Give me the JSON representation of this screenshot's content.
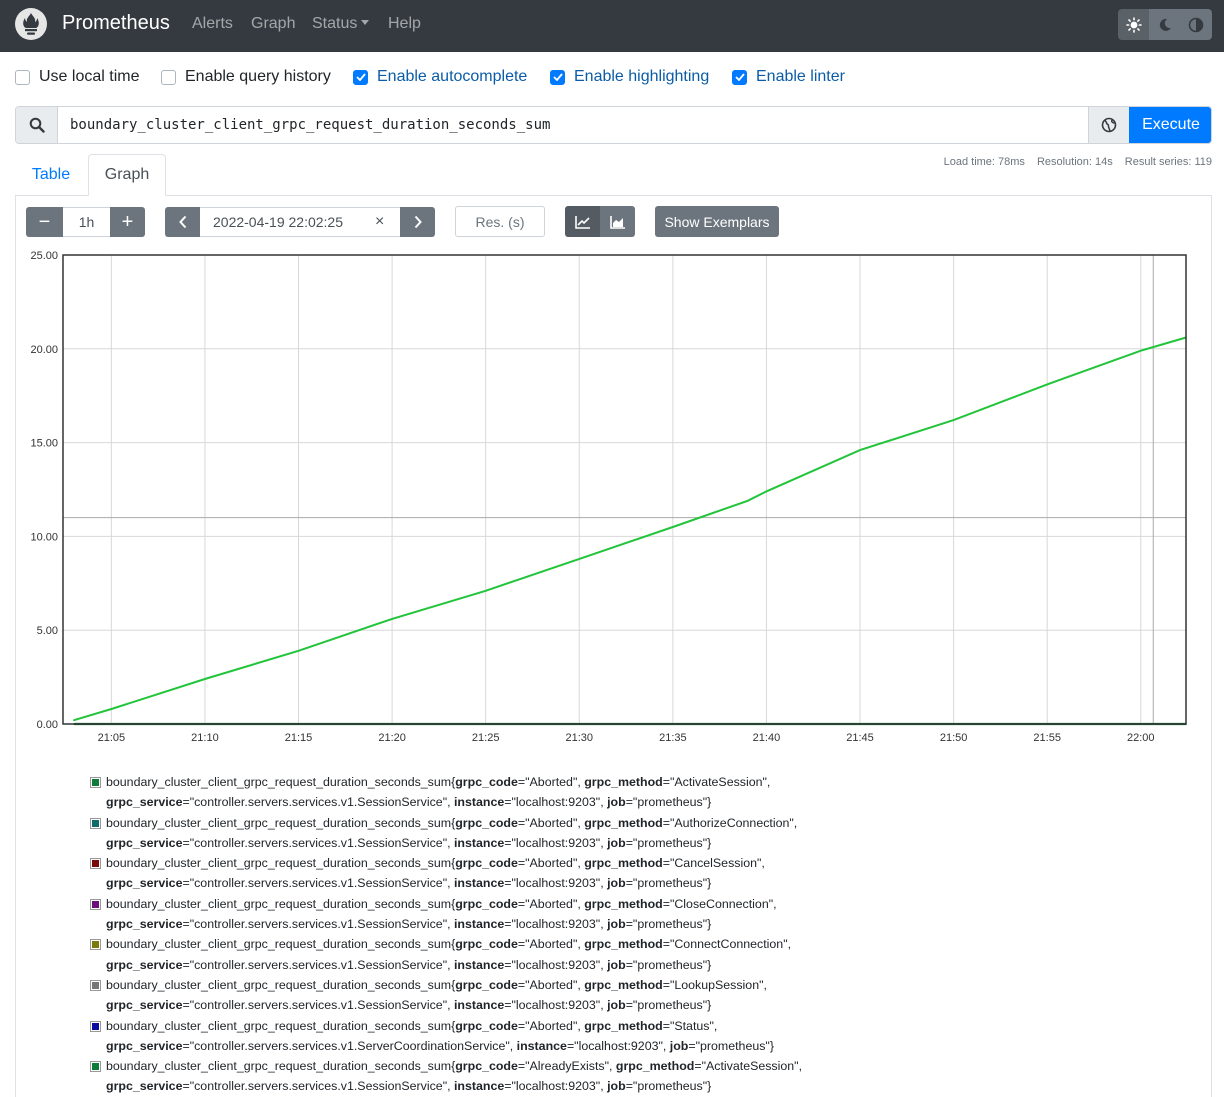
{
  "navbar": {
    "brand": "Prometheus",
    "items": [
      "Alerts",
      "Graph",
      "Status",
      "Help"
    ]
  },
  "options": {
    "local_time": {
      "label": "Use local time",
      "checked": false
    },
    "query_history": {
      "label": "Enable query history",
      "checked": false
    },
    "autocomplete": {
      "label": "Enable autocomplete",
      "checked": true
    },
    "highlighting": {
      "label": "Enable highlighting",
      "checked": true
    },
    "linter": {
      "label": "Enable linter",
      "checked": true
    }
  },
  "query": {
    "expression": "boundary_cluster_client_grpc_request_duration_seconds_sum",
    "execute_label": "Execute"
  },
  "stats": {
    "load_time": "Load time: 78ms",
    "resolution": "Resolution: 14s",
    "result_series": "Result series: 119"
  },
  "tabs": {
    "table": "Table",
    "graph": "Graph"
  },
  "controls": {
    "minus": "−",
    "range": "1h",
    "plus": "+",
    "end_time": "2022-04-19 22:02:25",
    "clear": "×",
    "res_placeholder": "Res. (s)",
    "show_exemplars": "Show Exemplars"
  },
  "colors": {
    "navbar": "#343a40",
    "primary": "#007bff",
    "series_main": "#22c43a",
    "series_flat": "#0f7b3a"
  },
  "chart_data": {
    "type": "line",
    "x_ticks": [
      "21:05",
      "21:10",
      "21:15",
      "21:20",
      "21:25",
      "21:30",
      "21:35",
      "21:40",
      "21:45",
      "21:50",
      "21:55",
      "22:00"
    ],
    "y_ticks": [
      "0.00",
      "5.00",
      "10.00",
      "15.00",
      "20.00",
      "25.00"
    ],
    "ylim": [
      0,
      25
    ],
    "xlim_minutes": [
      "21:02:25",
      "22:02:25"
    ],
    "series": [
      {
        "color": "#22c43a",
        "x": [
          "21:03",
          "21:05",
          "21:10",
          "21:15",
          "21:20",
          "21:25",
          "21:30",
          "21:35",
          "21:39",
          "21:40",
          "21:45",
          "21:50",
          "21:55",
          "22:00",
          "22:02:25"
        ],
        "values": [
          0.2,
          0.8,
          2.4,
          3.9,
          5.6,
          7.1,
          8.8,
          10.5,
          11.9,
          12.4,
          14.6,
          16.2,
          18.1,
          19.9,
          20.6
        ]
      },
      {
        "color": "#0f7b3a",
        "x": [
          "21:03",
          "22:02:25"
        ],
        "values": [
          0,
          0
        ]
      }
    ]
  },
  "legend": [
    {
      "color": "#0f7b3a",
      "metric": "boundary_cluster_client_grpc_request_duration_seconds_sum",
      "code": "Aborted",
      "method": "ActivateSession",
      "service": "controller.servers.services.v1.SessionService",
      "instance": "localhost:9203",
      "job": "prometheus"
    },
    {
      "color": "#0f6b6b",
      "metric": "boundary_cluster_client_grpc_request_duration_seconds_sum",
      "code": "Aborted",
      "method": "AuthorizeConnection",
      "service": "controller.servers.services.v1.SessionService",
      "instance": "localhost:9203",
      "job": "prometheus"
    },
    {
      "color": "#7a0a0a",
      "metric": "boundary_cluster_client_grpc_request_duration_seconds_sum",
      "code": "Aborted",
      "method": "CancelSession",
      "service": "controller.servers.services.v1.SessionService",
      "instance": "localhost:9203",
      "job": "prometheus"
    },
    {
      "color": "#6d0f7a",
      "metric": "boundary_cluster_client_grpc_request_duration_seconds_sum",
      "code": "Aborted",
      "method": "CloseConnection",
      "service": "controller.servers.services.v1.SessionService",
      "instance": "localhost:9203",
      "job": "prometheus"
    },
    {
      "color": "#7a7a0a",
      "metric": "boundary_cluster_client_grpc_request_duration_seconds_sum",
      "code": "Aborted",
      "method": "ConnectConnection",
      "service": "controller.servers.services.v1.SessionService",
      "instance": "localhost:9203",
      "job": "prometheus"
    },
    {
      "color": "#777777",
      "metric": "boundary_cluster_client_grpc_request_duration_seconds_sum",
      "code": "Aborted",
      "method": "LookupSession",
      "service": "controller.servers.services.v1.SessionService",
      "instance": "localhost:9203",
      "job": "prometheus"
    },
    {
      "color": "#0a0aa0",
      "metric": "boundary_cluster_client_grpc_request_duration_seconds_sum",
      "code": "Aborted",
      "method": "Status",
      "service": "controller.servers.services.v1.ServerCoordinationService",
      "instance": "localhost:9203",
      "job": "prometheus"
    },
    {
      "color": "#0f7b3a",
      "metric": "boundary_cluster_client_grpc_request_duration_seconds_sum",
      "code": "AlreadyExists",
      "method": "ActivateSession",
      "service": "controller.servers.services.v1.SessionService",
      "instance": "localhost:9203",
      "job": "prometheus"
    }
  ]
}
